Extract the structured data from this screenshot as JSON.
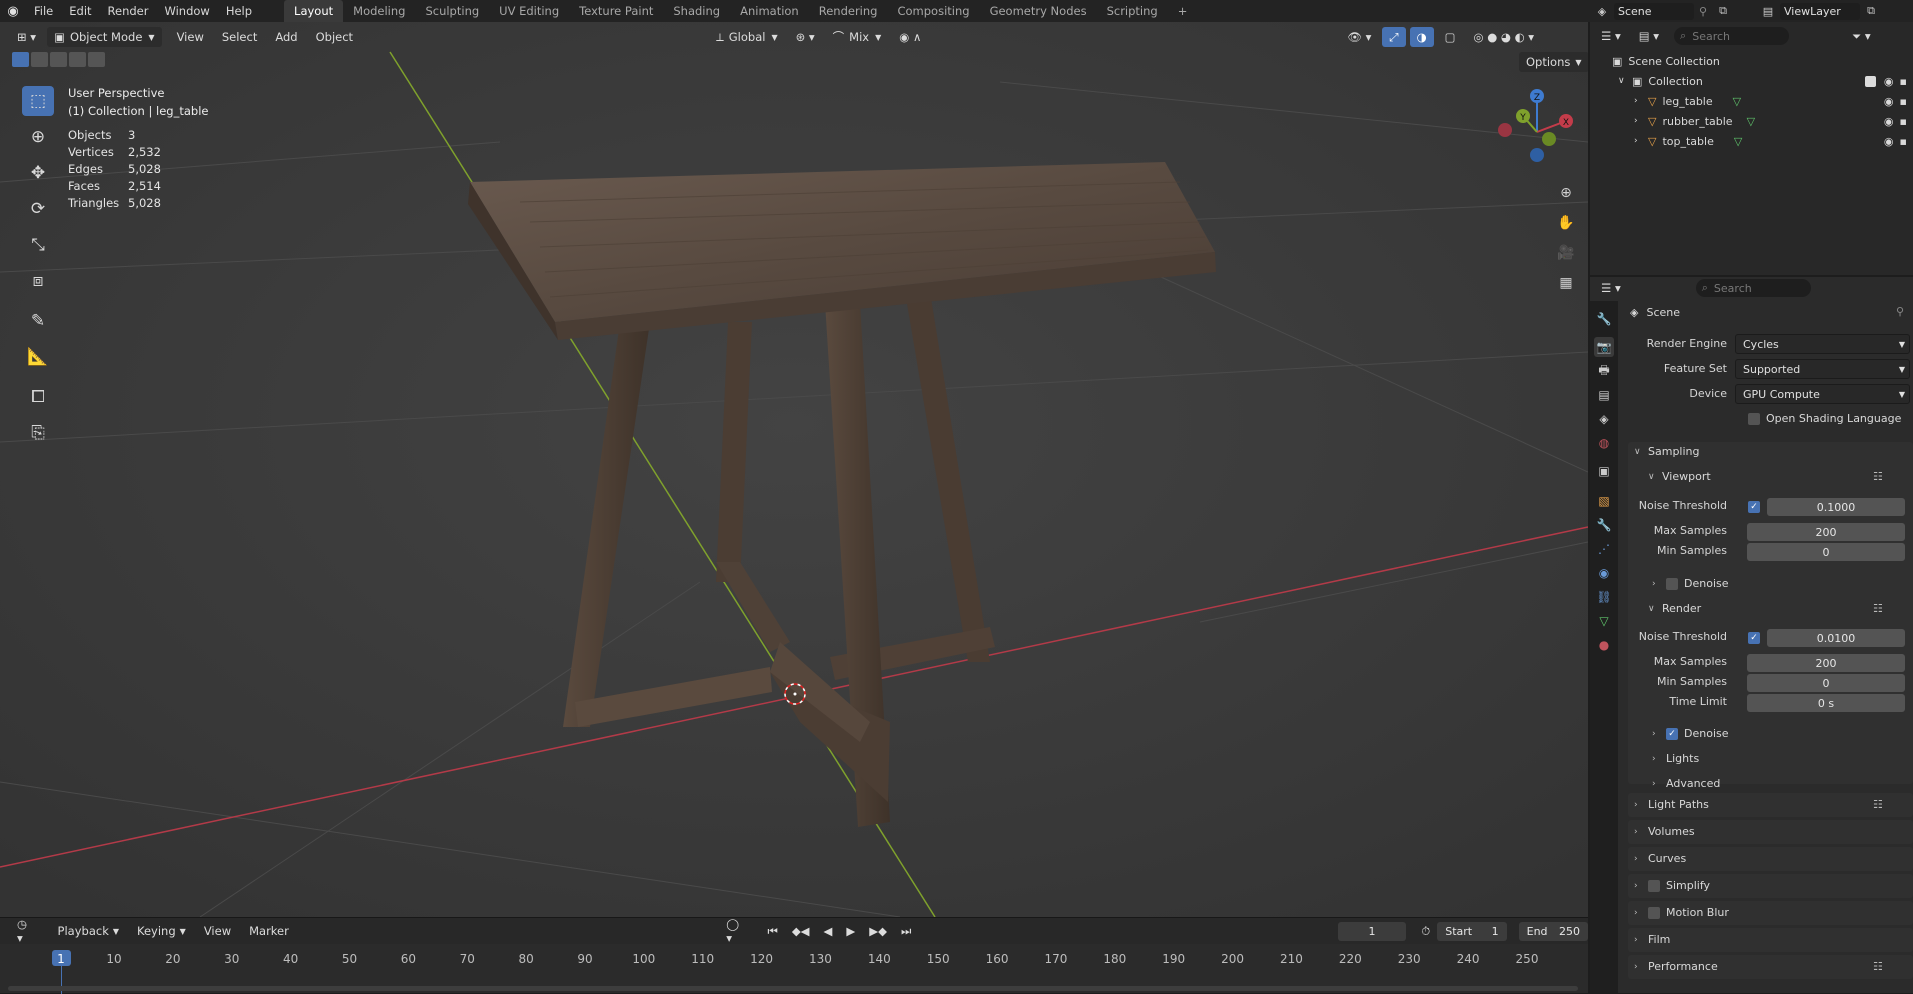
{
  "menu": [
    "File",
    "Edit",
    "Render",
    "Window",
    "Help"
  ],
  "workspaces": [
    "Layout",
    "Modeling",
    "Sculpting",
    "UV Editing",
    "Texture Paint",
    "Shading",
    "Animation",
    "Rendering",
    "Compositing",
    "Geometry Nodes",
    "Scripting"
  ],
  "active_workspace": "Layout",
  "scene_name": "Scene",
  "view_layer": "ViewLayer",
  "viewport": {
    "mode": "Object Mode",
    "menus": [
      "View",
      "Select",
      "Add",
      "Object"
    ],
    "transform_orientation": "Global",
    "snap_mode": "Mix",
    "options": "Options",
    "perspective": "User Perspective",
    "collection_path": "(1) Collection | leg_table",
    "stats": [
      {
        "label": "Objects",
        "value": "3"
      },
      {
        "label": "Vertices",
        "value": "2,532"
      },
      {
        "label": "Edges",
        "value": "5,028"
      },
      {
        "label": "Faces",
        "value": "2,514"
      },
      {
        "label": "Triangles",
        "value": "5,028"
      }
    ],
    "gizmo": {
      "x": "X",
      "y": "Y",
      "z": "Z"
    },
    "colors": {
      "x_axis": "#c33c4a",
      "y_axis": "#7fa12c",
      "z_axis": "#3e7bd0",
      "accent": "#4772b3"
    }
  },
  "timeline": {
    "menus": [
      "Playback",
      "Keying",
      "View",
      "Marker"
    ],
    "current_frame": "1",
    "start_label": "Start",
    "start": "1",
    "end_label": "End",
    "end": "250",
    "ticks": [
      "1",
      "10",
      "20",
      "30",
      "40",
      "50",
      "60",
      "70",
      "80",
      "90",
      "100",
      "110",
      "120",
      "130",
      "140",
      "150",
      "160",
      "170",
      "180",
      "190",
      "200",
      "210",
      "220",
      "230",
      "240",
      "250"
    ]
  },
  "outliner": {
    "search_placeholder": "Search",
    "root": "Scene Collection",
    "collection": "Collection",
    "objects": [
      "leg_table",
      "rubber_table",
      "top_table"
    ]
  },
  "properties": {
    "search_placeholder": "Search",
    "context": "Scene",
    "render_engine_label": "Render Engine",
    "render_engine": "Cycles",
    "feature_set_label": "Feature Set",
    "feature_set": "Supported",
    "device_label": "Device",
    "device": "GPU Compute",
    "osl": "Open Shading Language",
    "sampling": "Sampling",
    "viewport_section": "Viewport",
    "noise_threshold_label": "Noise Threshold",
    "max_samples_label": "Max Samples",
    "min_samples_label": "Min Samples",
    "viewport_noise_threshold": "0.1000",
    "viewport_max_samples": "200",
    "viewport_min_samples": "0",
    "denoise": "Denoise",
    "render_section": "Render",
    "render_noise_threshold": "0.0100",
    "render_max_samples": "200",
    "render_min_samples": "0",
    "time_limit_label": "Time Limit",
    "time_limit": "0 s",
    "lights": "Lights",
    "advanced": "Advanced",
    "light_paths": "Light Paths",
    "volumes": "Volumes",
    "curves": "Curves",
    "simplify": "Simplify",
    "motion_blur": "Motion Blur",
    "film": "Film",
    "performance": "Performance"
  }
}
